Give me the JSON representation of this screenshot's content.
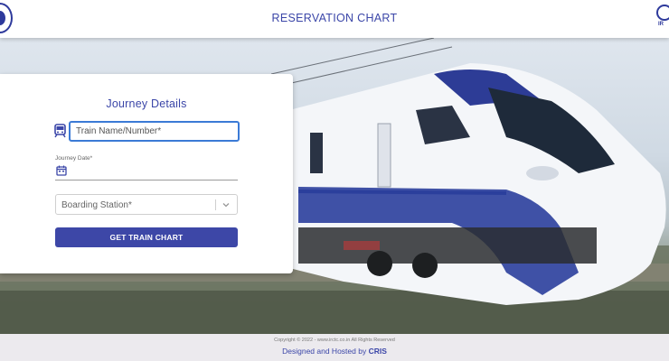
{
  "header": {
    "title": "RESERVATION CHART",
    "right_logo_text": "IR"
  },
  "form": {
    "title": "Journey Details",
    "train_placeholder": "Train Name/Number*",
    "date_label": "Journey Date*",
    "station_placeholder": "Boarding Station*",
    "submit_label": "GET TRAIN CHART"
  },
  "footer": {
    "copyright": "Copyright © 2022 - www.irctc.co.in All Rights Reserved",
    "hosted_prefix": "Designed and Hosted by ",
    "hosted_org": "CRIS"
  },
  "colors": {
    "brand": "#3b46a8",
    "button": "#3d47a7",
    "focus_border": "#3b7ad6"
  },
  "icons": [
    "train-icon",
    "calendar-icon",
    "chevron-down-icon"
  ]
}
